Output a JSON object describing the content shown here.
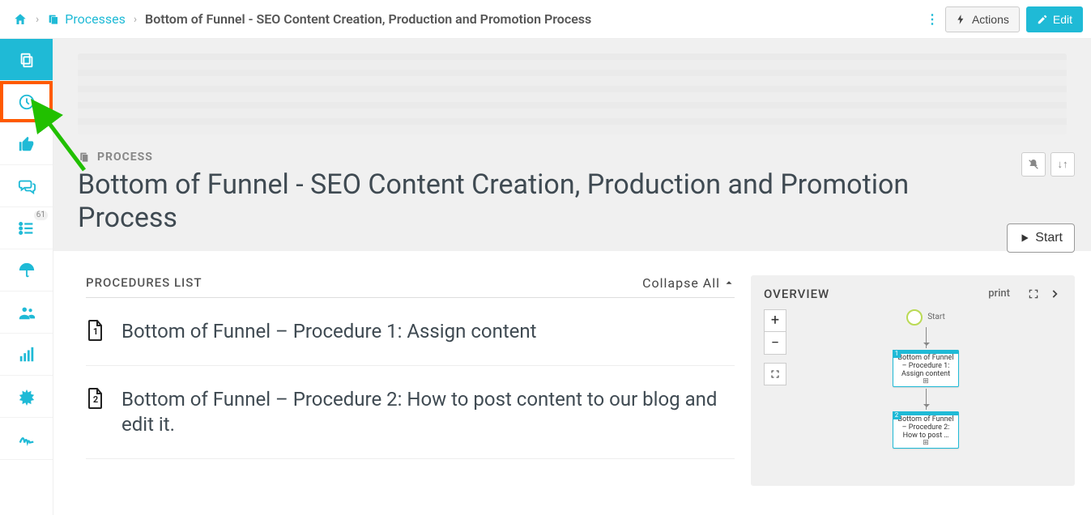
{
  "breadcrumb": {
    "section_label": "Processes",
    "current": "Bottom of Funnel - SEO Content Creation, Production and Promotion Process"
  },
  "topbar": {
    "actions_label": "Actions",
    "edit_label": "Edit"
  },
  "sidebar": {
    "checklist_badge": "61"
  },
  "hero": {
    "tag": "PROCESS",
    "title": "Bottom of Funnel - SEO Content Creation, Production and Promotion Process",
    "start_label": "Start"
  },
  "procedures": {
    "heading": "PROCEDURES LIST",
    "collapse_label": "Collapse All",
    "items": [
      {
        "n": "1",
        "title": "Bottom of Funnel – Procedure 1: Assign content"
      },
      {
        "n": "2",
        "title": "Bottom of Funnel – Procedure 2: How to post content to our blog and edit it."
      }
    ]
  },
  "overview": {
    "heading": "OVERVIEW",
    "print_label": "print",
    "flow": {
      "start_label": "Start",
      "nodes": [
        {
          "idx": "1",
          "text": "Bottom of Funnel – Procedure 1: Assign content"
        },
        {
          "idx": "2",
          "text": "Bottom of Funnel – Procedure 2: How to post …"
        }
      ]
    }
  }
}
